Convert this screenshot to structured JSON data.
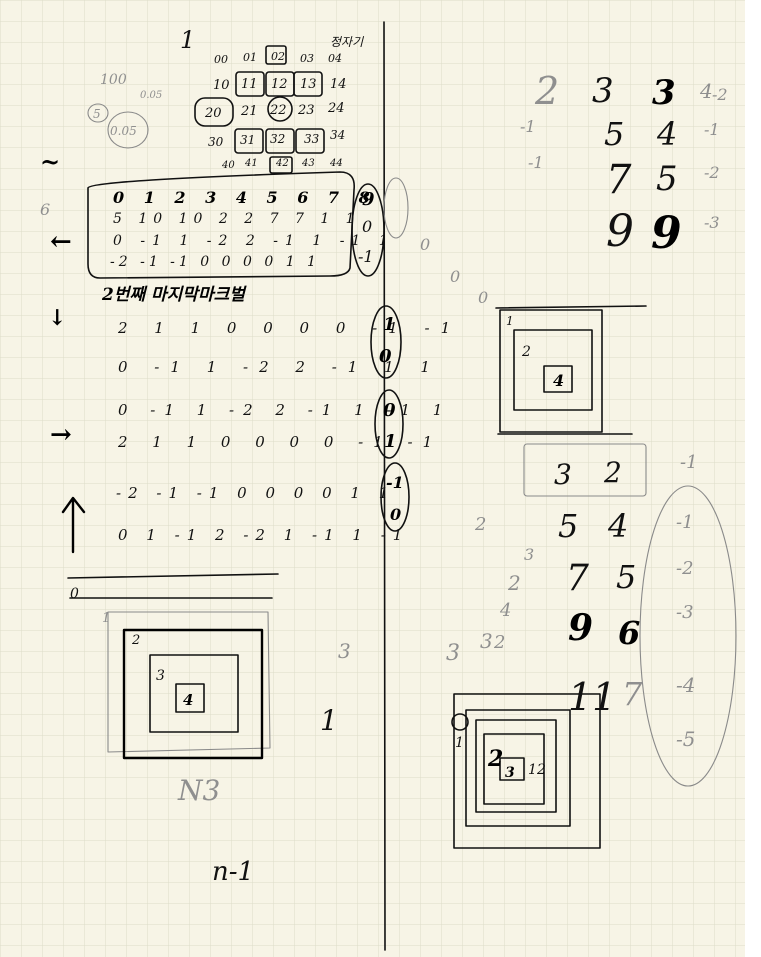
{
  "header": {
    "mark_one": "1",
    "title_scribble": "정자기",
    "scale": "100",
    "scale_small": "0.05",
    "circ_five": "5",
    "circ_005": "0.05"
  },
  "grid_codes": [
    [
      "00",
      "01",
      "02",
      "03",
      "04"
    ],
    [
      "10",
      "11",
      "12",
      "13",
      "14"
    ],
    [
      "20",
      "21",
      "22",
      "23",
      "24"
    ],
    [
      "30",
      "31",
      "32",
      "33",
      "34"
    ],
    [
      "40",
      "41",
      "42",
      "43",
      "44"
    ]
  ],
  "left_arrows": [
    "~",
    "6",
    "←",
    "↓",
    "→",
    "↑"
  ],
  "boxed_rows": [
    "0 1 2 3 4 5 6 7 8",
    "5 10 10 2 2 7 7 1 1",
    "0 -1 1 -2 2 -1 1 -1 1",
    "-2 -1 -1 0 0 0 0 1 1"
  ],
  "boxed_circle_values": [
    "9",
    "0",
    "-1"
  ],
  "korean_heading": "2번째  마지막마크벌",
  "down_rows": [
    "2 1 1 0 0 0 0 -1 -1",
    "0 -1 1 -2 2 -1 1 1"
  ],
  "down_circles": [
    "1",
    "0"
  ],
  "right_rows": [
    "0 -1 1 -2 2 -1 1 -1 1",
    "2 1 1 0 0 0 0 -1 -1"
  ],
  "right_circles": [
    "0",
    "1"
  ],
  "up_rows": [
    "-2 -1 -1 0 0 0 0 1 1",
    "0 1 -1 2 -2 1 -1 1 -1"
  ],
  "up_circles": [
    "-1",
    "0"
  ],
  "bottom_left": {
    "zero": "0",
    "labels": [
      "1",
      "2",
      "3",
      "4"
    ],
    "three": "3",
    "one": "1",
    "n3": "N3",
    "formula": "n-1"
  },
  "right_top": {
    "rows": [
      [
        "2",
        "3",
        "3",
        "4"
      ],
      [
        "5",
        "4"
      ],
      [
        "7",
        "5"
      ],
      [
        "9",
        "9"
      ]
    ],
    "side_marks": [
      "-1",
      "-1",
      "-2",
      "-1",
      "-2",
      "-3"
    ],
    "zeros": [
      "0",
      "0",
      "0"
    ]
  },
  "right_squares": {
    "labels": [
      "1",
      "2",
      "4"
    ]
  },
  "right_table": {
    "rows": [
      [
        "3",
        "2"
      ],
      [
        "5",
        "4"
      ],
      [
        "7",
        "5"
      ],
      [
        "9",
        "6"
      ],
      [
        "11",
        "7"
      ]
    ],
    "ovals": [
      "-1",
      "-1",
      "-2",
      "-3",
      "-4",
      "-5"
    ],
    "side_nums": [
      "2",
      "3",
      "2",
      "4",
      "3",
      "3",
      "2"
    ]
  },
  "right_bottom_squares": {
    "labels": [
      "1",
      "2",
      "3",
      "1",
      "2"
    ]
  }
}
